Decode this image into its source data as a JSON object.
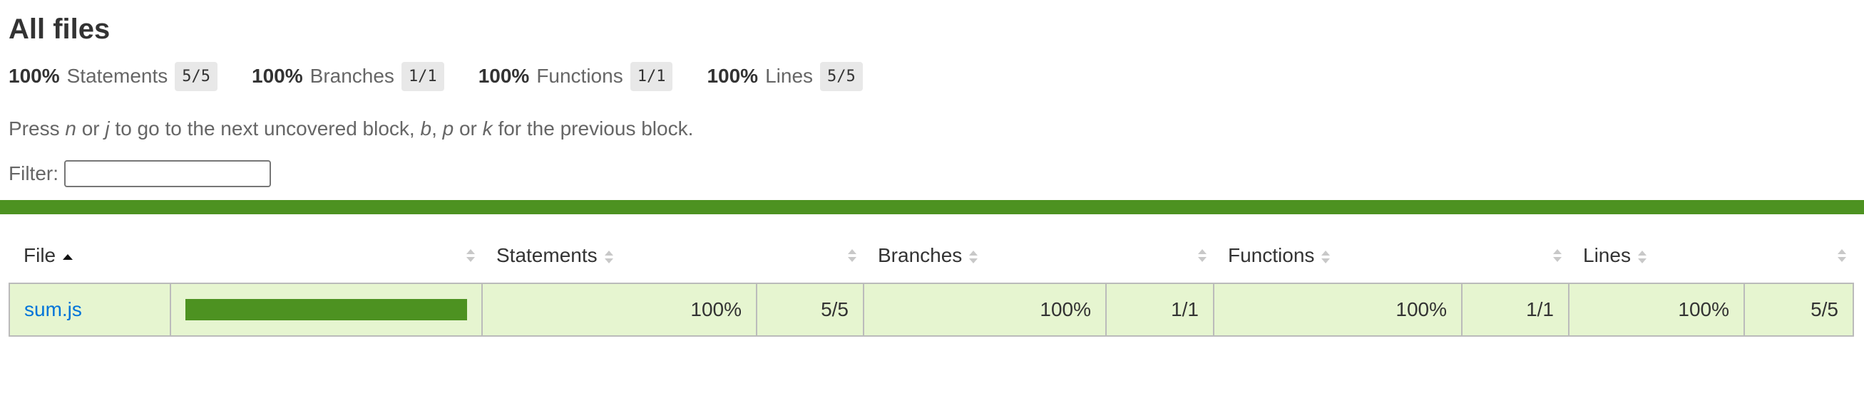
{
  "page": {
    "title": "All files",
    "hint": {
      "press": "Press ",
      "key_n": "n",
      "or1": " or ",
      "key_j": "j",
      "mid": " to go to the next uncovered block, ",
      "key_b": "b",
      "comma": ", ",
      "key_p": "p",
      "or2": " or ",
      "key_k": "k",
      "end": " for the previous block."
    },
    "filter_label": "Filter:",
    "filter_value": ""
  },
  "summary": [
    {
      "pct": "100%",
      "label": "Statements",
      "frac": "5/5"
    },
    {
      "pct": "100%",
      "label": "Branches",
      "frac": "1/1"
    },
    {
      "pct": "100%",
      "label": "Functions",
      "frac": "1/1"
    },
    {
      "pct": "100%",
      "label": "Lines",
      "frac": "5/5"
    }
  ],
  "colors": {
    "high_coverage": "#4d9221",
    "row_high_bg": "#e6f5d0",
    "link": "#0074d9"
  },
  "table": {
    "headers": {
      "file": "File",
      "statements": "Statements",
      "branches": "Branches",
      "functions": "Functions",
      "lines": "Lines"
    },
    "rows": [
      {
        "file": "sum.js",
        "coverage_fraction": 1.0,
        "statements_pct": "100%",
        "statements_frac": "5/5",
        "branches_pct": "100%",
        "branches_frac": "1/1",
        "functions_pct": "100%",
        "functions_frac": "1/1",
        "lines_pct": "100%",
        "lines_frac": "5/5"
      }
    ]
  }
}
